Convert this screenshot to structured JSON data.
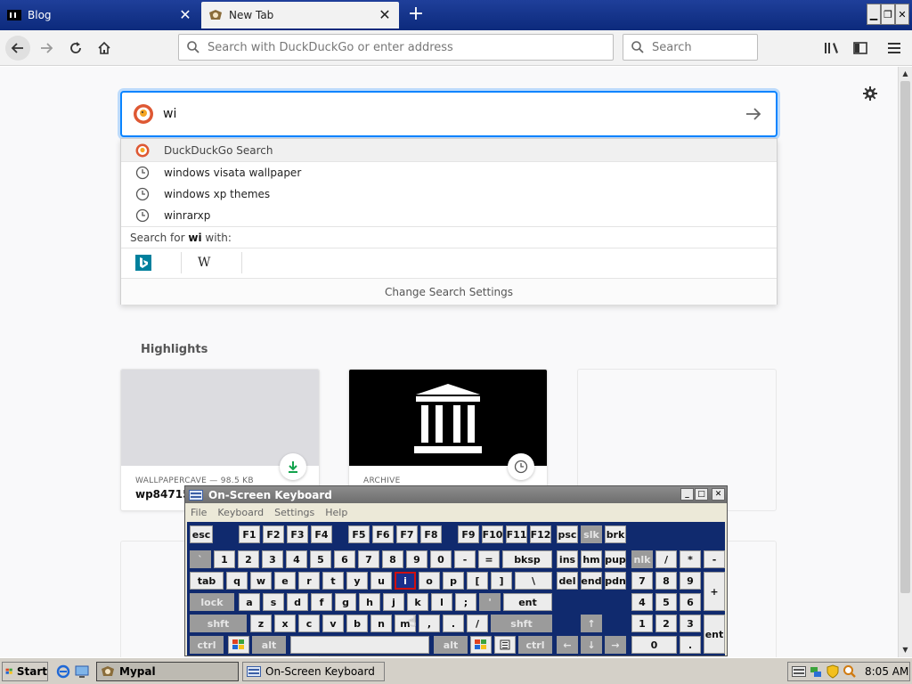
{
  "browser": {
    "tabs": [
      {
        "label": "Blog"
      },
      {
        "label": "New Tab"
      }
    ],
    "url_placeholder": "Search with DuckDuckGo or enter address",
    "search_placeholder": "Search"
  },
  "page": {
    "search_value": "wi",
    "dropdown": {
      "engine_row": "DuckDuckGo Search",
      "history": [
        "windows visata wallpaper",
        "windows xp themes",
        "winrarxp"
      ],
      "search_for_prefix": "Search for ",
      "search_for_term": "wi",
      "search_for_suffix": " with:",
      "engines": [
        "Bing",
        "W"
      ],
      "change_settings": "Change Search Settings"
    },
    "highlights_title": "Highlights",
    "cards": [
      {
        "meta": "WALLPAPERCAVE — 98.5 KB",
        "title": "wp847159"
      },
      {
        "meta": "ARCHIVE",
        "title": ""
      }
    ]
  },
  "osk": {
    "title": "On-Screen Keyboard",
    "menu": [
      "File",
      "Keyboard",
      "Settings",
      "Help"
    ],
    "keys": {
      "row0": [
        "esc",
        "F1",
        "F2",
        "F3",
        "F4",
        "F5",
        "F6",
        "F7",
        "F8",
        "F9",
        "F10",
        "F11",
        "F12",
        "psc",
        "slk",
        "brk"
      ],
      "row1": [
        "`",
        "1",
        "2",
        "3",
        "4",
        "5",
        "6",
        "7",
        "8",
        "9",
        "0",
        "-",
        "=",
        "bksp",
        "ins",
        "hm",
        "pup",
        "nlk",
        "/",
        "*",
        "-"
      ],
      "row2": [
        "tab",
        "q",
        "w",
        "e",
        "r",
        "t",
        "y",
        "u",
        "i",
        "o",
        "p",
        "[",
        "]",
        "\\",
        "del",
        "end",
        "pdn",
        "7",
        "8",
        "9",
        "+"
      ],
      "row3": [
        "lock",
        "a",
        "s",
        "d",
        "f",
        "g",
        "h",
        "j",
        "k",
        "l",
        ";",
        "'",
        "ent",
        "4",
        "5",
        "6"
      ],
      "row4": [
        "shft",
        "z",
        "x",
        "c",
        "v",
        "b",
        "n",
        "m",
        ",",
        ".",
        "/",
        "shft",
        "↑",
        "1",
        "2",
        "3"
      ],
      "row5": [
        "ctrl",
        "alt",
        "alt",
        "ctrl",
        "←",
        "↓",
        "→",
        "0",
        ".",
        "ent"
      ]
    }
  },
  "taskbar": {
    "start": "Start",
    "tasks": [
      "Mypal",
      "On-Screen Keyboard"
    ],
    "clock": "8:05 AM"
  },
  "colors": {
    "accent": "#0a84ff",
    "tabstrip": "#1a3a92",
    "osk_keys_bg": "#102a6e",
    "active_key_border": "#d01010"
  }
}
